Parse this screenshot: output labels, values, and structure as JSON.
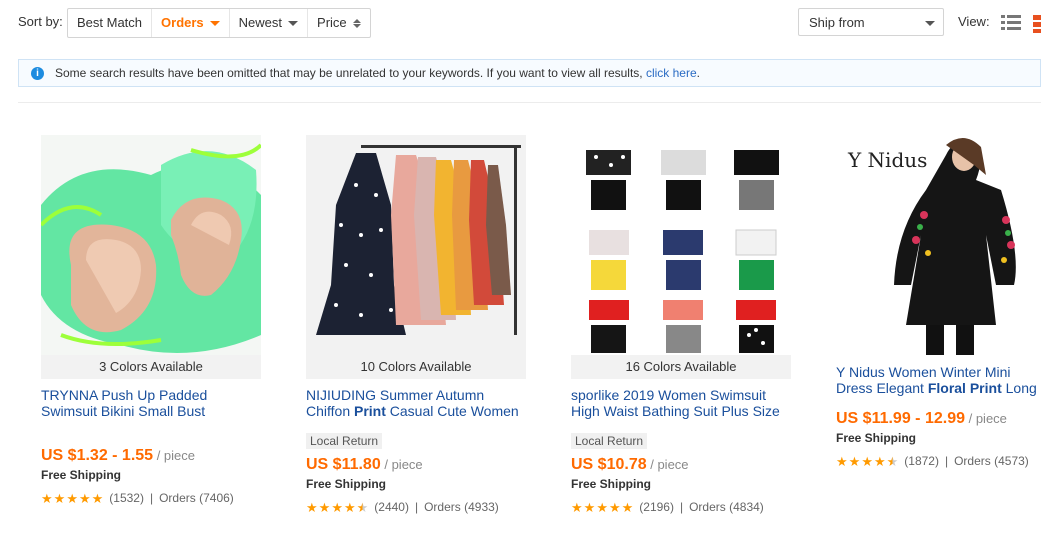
{
  "toolbar": {
    "sort_label": "Sort by:",
    "sort_options": [
      "Best Match",
      "Orders",
      "Newest",
      "Price"
    ],
    "ship_from": "Ship from",
    "view_label": "View:"
  },
  "notice": {
    "text": "Some search results have been omitted that may be unrelated to your keywords. If you want to view all results, ",
    "link": "click here",
    "after": "."
  },
  "colors": {
    "accent": "#ff7300",
    "price": "#ff6a00",
    "link": "#1a4f9c",
    "star": "#ff9a00"
  },
  "products": [
    {
      "colors_available": "3 Colors Available",
      "title_a": "TRYNNA Push Up Padded Swimsuit Bikini Small Bust",
      "title_b": "",
      "title_c": "",
      "badge": "",
      "price": "US $1.32 - 1.55",
      "unit": " / piece",
      "shipping": "Free Shipping",
      "stars": 5,
      "reviews": "(1532)",
      "orders": "Orders (7406)"
    },
    {
      "colors_available": "10 Colors Available",
      "title_a": "NIJIUDING Summer Autumn Chiffon ",
      "title_b": "Print",
      "title_c": " Casual Cute Women",
      "badge": "Local Return",
      "price": "US $11.80",
      "unit": " / piece",
      "shipping": "Free Shipping",
      "stars": 4.5,
      "reviews": "(2440)",
      "orders": "Orders (4933)"
    },
    {
      "colors_available": "16 Colors Available",
      "title_a": "sporlike 2019 Women Swimsuit High Waist Bathing Suit Plus Size",
      "title_b": "",
      "title_c": "",
      "badge": "Local Return",
      "price": "US $10.78",
      "unit": " / piece",
      "shipping": "Free Shipping",
      "stars": 5,
      "reviews": "(2196)",
      "orders": "Orders (4834)"
    },
    {
      "colors_available": "",
      "image_caption": "Y Nidus",
      "title_a": "Y Nidus Women Winter Mini Dress Elegant ",
      "title_b": "Floral Print",
      "title_c": " Long",
      "badge": "",
      "price": "US $11.99 - 12.99",
      "unit": " / piece",
      "shipping": "Free Shipping",
      "stars": 4.5,
      "reviews": "(1872)",
      "orders": "Orders (4573)"
    }
  ]
}
